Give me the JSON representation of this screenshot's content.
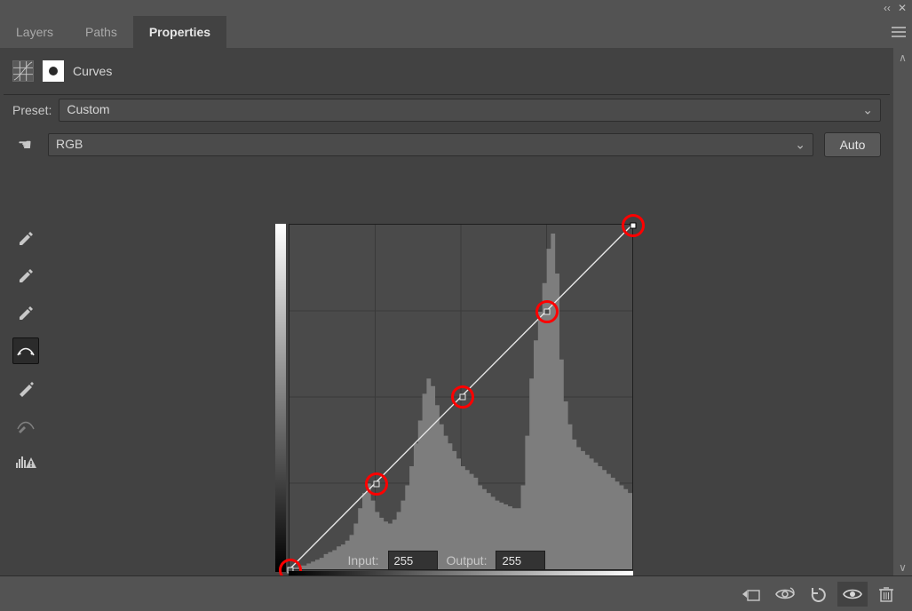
{
  "window": {
    "collapse_icon": "‹‹",
    "close_icon": "✕"
  },
  "tabs": {
    "layers": "Layers",
    "paths": "Paths",
    "properties": "Properties"
  },
  "header": {
    "panel_type": "Curves"
  },
  "preset": {
    "label": "Preset:",
    "value": "Custom"
  },
  "channel": {
    "value": "RGB",
    "hand_glyph": "☚",
    "auto_label": "Auto"
  },
  "io": {
    "input_label": "Input:",
    "input_value": "255",
    "output_label": "Output:",
    "output_value": "255"
  },
  "chart_data": {
    "type": "line",
    "title": "Curves",
    "xlabel": "Input",
    "ylabel": "Output",
    "xlim": [
      0,
      255
    ],
    "ylim": [
      0,
      255
    ],
    "series": [
      {
        "name": "RGB curve",
        "points": [
          {
            "in": 0,
            "out": 0
          },
          {
            "in": 64,
            "out": 64
          },
          {
            "in": 128,
            "out": 128
          },
          {
            "in": 191,
            "out": 191
          },
          {
            "in": 255,
            "out": 255
          }
        ],
        "selected_point_index": 4
      }
    ],
    "histogram": [
      1,
      1,
      2,
      2,
      3,
      4,
      5,
      6,
      8,
      9,
      10,
      12,
      13,
      15,
      18,
      24,
      32,
      40,
      45,
      36,
      30,
      27,
      25,
      24,
      26,
      30,
      36,
      44,
      54,
      66,
      78,
      92,
      100,
      96,
      86,
      76,
      70,
      66,
      62,
      58,
      54,
      52,
      50,
      48,
      44,
      42,
      40,
      38,
      36,
      35,
      34,
      33,
      32,
      32,
      44,
      70,
      100,
      120,
      135,
      150,
      168,
      176,
      155,
      110,
      88,
      76,
      68,
      64,
      62,
      60,
      58,
      56,
      54,
      52,
      50,
      48,
      46,
      44,
      42,
      40
    ],
    "highlights": [
      0,
      1,
      2,
      3,
      4
    ]
  }
}
